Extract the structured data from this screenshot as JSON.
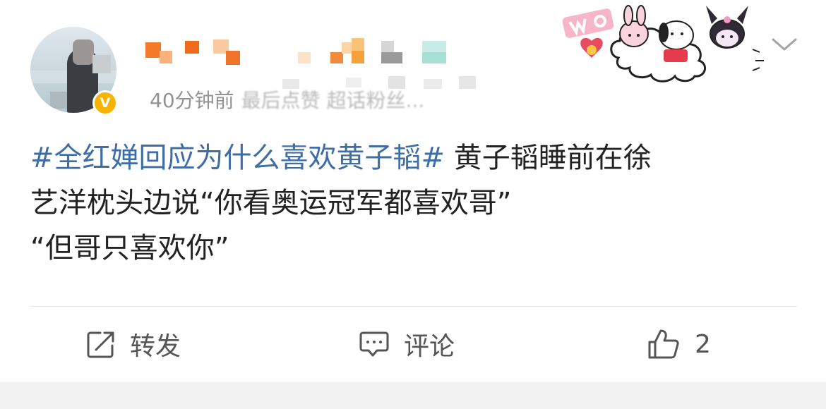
{
  "post": {
    "time": "40分钟前",
    "source": "最后点赞 超话粉丝...",
    "topic": "#全红婵回应为什么喜欢黄子韬#",
    "text_line1_rest": " 黄子韬睡前在徐",
    "text_line2": "艺洋枕头边说“你看奥运冠军都喜欢哥”",
    "text_line3": "“但哥只喜欢你”"
  },
  "actions": {
    "repost_label": "转发",
    "comment_label": "评论",
    "like_count": "2"
  },
  "badge": {
    "verified_letter": "V"
  },
  "colors": {
    "topic_link": "#3f6ea6",
    "text": "#222222",
    "meta": "#939393",
    "verified_badge": "#f6b400"
  }
}
